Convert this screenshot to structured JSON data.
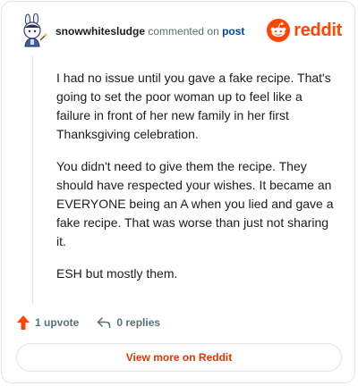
{
  "header": {
    "username": "snowwhitesludge",
    "action_text": "commented on",
    "post_link": "post",
    "brand": "reddit"
  },
  "comment": {
    "paragraphs": [
      "I had no issue until you gave a fake recipe. That's going to set the poor woman up to feel like a failure in front of her new family in her first Thanksgiving celebration.",
      "You didn't need to give them the recipe. They should have respected your wishes. It became an EVERYONE being an A when you lied and gave a fake recipe. That was worse than just not sharing it.",
      "ESH but mostly them."
    ]
  },
  "actions": {
    "upvotes": "1 upvote",
    "replies": "0 replies"
  },
  "footer": {
    "view_more": "View more on Reddit"
  },
  "colors": {
    "brand": "#ff4500",
    "upvote": "#ff4500",
    "link": "#0045ac",
    "view_more": "#d93900"
  },
  "icons": {
    "avatar": "avatar-icon",
    "brand": "reddit-snoo-icon",
    "upvote": "upvote-arrow-icon",
    "reply": "reply-arrow-icon"
  }
}
